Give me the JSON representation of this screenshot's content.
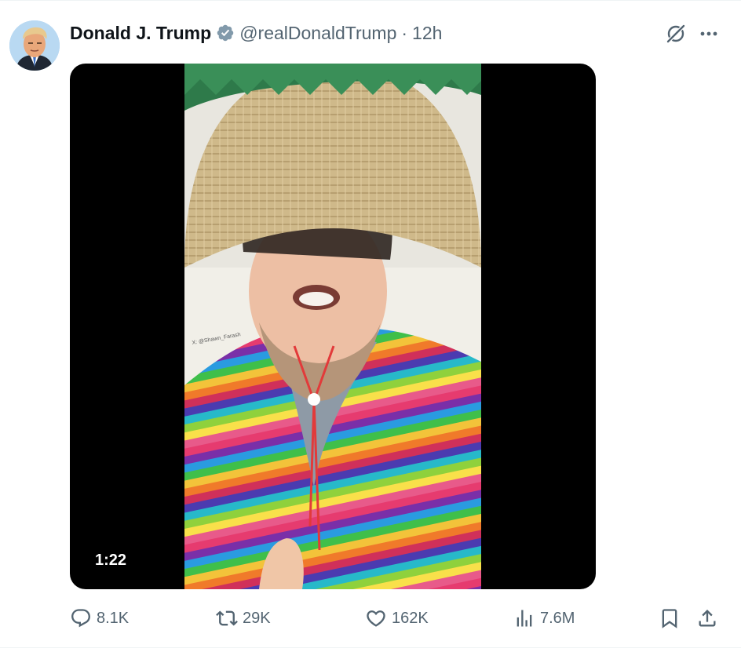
{
  "post": {
    "author": {
      "display_name": "Donald J. Trump",
      "handle": "@realDonaldTrump",
      "verified": true,
      "verified_color": "#829aab"
    },
    "separator": "·",
    "time": "12h",
    "grok_icon": "grok-icon",
    "more_icon": "more-icon",
    "media": {
      "type": "video",
      "duration": "1:22",
      "watermark": "X: @Shawn_Farash"
    },
    "metrics": {
      "replies": "8.1K",
      "reposts": "29K",
      "likes": "162K",
      "views": "7.6M"
    },
    "icons": {
      "reply": "reply-icon",
      "repost": "repost-icon",
      "like": "heart-icon",
      "views": "views-icon",
      "bookmark": "bookmark-icon",
      "share": "share-icon"
    },
    "colors": {
      "text_primary": "#0f1419",
      "text_secondary": "#536471",
      "media_background": "#000000"
    }
  }
}
